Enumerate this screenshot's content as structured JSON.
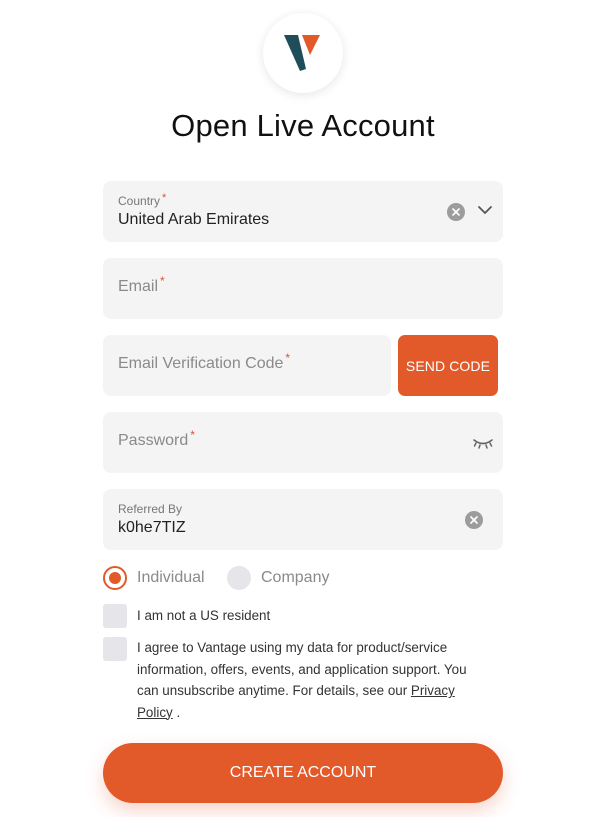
{
  "title": "Open Live Account",
  "brand": {
    "accent": "#e2592a",
    "logo_dark": "#1f4e5a"
  },
  "country": {
    "label": "Country",
    "required_mark": "*",
    "value": "United Arab Emirates"
  },
  "email": {
    "placeholder": "Email",
    "required_mark": "*"
  },
  "verification": {
    "placeholder": "Email Verification Code",
    "required_mark": "*",
    "button": "SEND CODE"
  },
  "password": {
    "placeholder": "Password",
    "required_mark": "*"
  },
  "referred": {
    "label": "Referred By",
    "value": "k0he7TIZ"
  },
  "account_type": {
    "options": [
      {
        "label": "Individual",
        "selected": true
      },
      {
        "label": "Company",
        "selected": false
      }
    ]
  },
  "checks": {
    "us_resident": "I am not a US resident",
    "consent_line1": "I agree to Vantage using my data for product/service",
    "consent_line2": "information, offers, events, and application support. You",
    "consent_line3_prefix": "can unsubscribe anytime. For details, see our ",
    "privacy_link_1": "Privacy",
    "privacy_link_2": "Policy",
    "consent_end": " ."
  },
  "submit": "CREATE ACCOUNT"
}
